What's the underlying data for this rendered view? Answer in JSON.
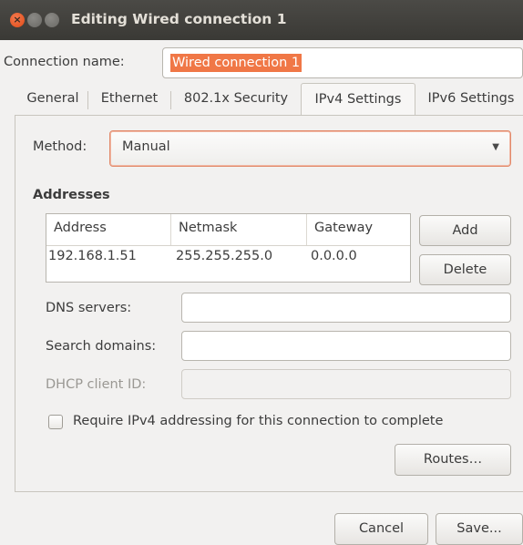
{
  "window": {
    "title": "Editing Wired connection 1"
  },
  "connection": {
    "name_label": "Connection name:",
    "name_value": "Wired connection 1"
  },
  "tabs": [
    {
      "label": "General"
    },
    {
      "label": "Ethernet"
    },
    {
      "label": "802.1x Security"
    },
    {
      "label": "IPv4 Settings"
    },
    {
      "label": "IPv6 Settings"
    }
  ],
  "ipv4": {
    "method_label": "Method:",
    "method_value": "Manual",
    "addresses_label": "Addresses",
    "columns": [
      "Address",
      "Netmask",
      "Gateway"
    ],
    "rows": [
      {
        "address": "192.168.1.51",
        "netmask": "255.255.255.0",
        "gateway": "0.0.0.0"
      }
    ],
    "add_label": "Add",
    "delete_label": "Delete",
    "dns_label": "DNS servers:",
    "dns_value": "",
    "search_label": "Search domains:",
    "search_value": "",
    "dhcp_label": "DHCP client ID:",
    "dhcp_value": "",
    "require_label": "Require IPv4 addressing for this connection to complete",
    "routes_label": "Routes…"
  },
  "footer": {
    "cancel_label": "Cancel",
    "save_label": "Save..."
  },
  "colors": {
    "titlebar": "#3c3b37",
    "accent": "#e95420",
    "selection": "#f07746"
  }
}
